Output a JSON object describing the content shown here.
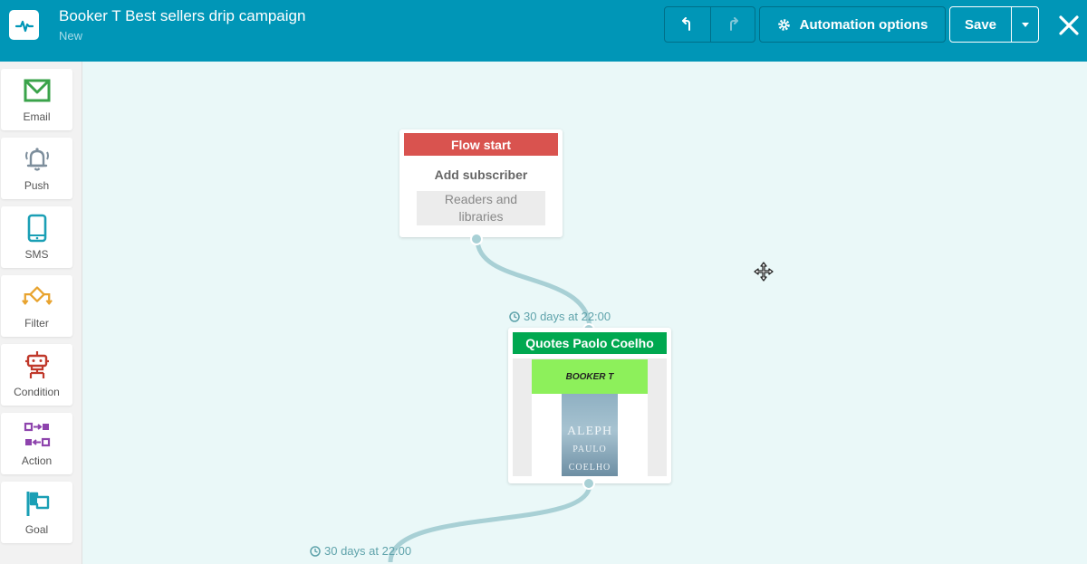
{
  "header": {
    "title": "Booker T Best sellers drip campaign",
    "subtitle": "New",
    "automation_options_label": "Automation options",
    "save_label": "Save",
    "colors": {
      "background": "#0096b7",
      "text": "#ffffff"
    }
  },
  "sidebar": {
    "items": [
      {
        "label": "Email",
        "icon": "email-icon",
        "color": "#3aa34a"
      },
      {
        "label": "Push",
        "icon": "bell-icon",
        "color": "#7d8e9c"
      },
      {
        "label": "SMS",
        "icon": "phone-icon",
        "color": "#1a9fb5"
      },
      {
        "label": "Filter",
        "icon": "filter-icon",
        "color": "#e8a32e"
      },
      {
        "label": "Condition",
        "icon": "condition-icon",
        "color": "#c0392b"
      },
      {
        "label": "Action",
        "icon": "action-icon",
        "color": "#8e44ad"
      },
      {
        "label": "Goal",
        "icon": "flag-icon",
        "color": "#1a9fb5"
      }
    ]
  },
  "canvas": {
    "flow_start": {
      "header": "Flow start",
      "title": "Add subscriber",
      "list_line1": "Readers and",
      "list_line2": "libraries",
      "color": "#d9534f"
    },
    "delay_1": "30 days at 22:00",
    "email_step": {
      "header": "Quotes Paolo Coelho",
      "color": "#00a850",
      "preview": {
        "banner_text": "BOOKER T",
        "book_title": "ALEPH",
        "book_author_1": "PAULO",
        "book_author_2": "COELHO"
      }
    },
    "delay_2": "30 days at 22:00"
  }
}
